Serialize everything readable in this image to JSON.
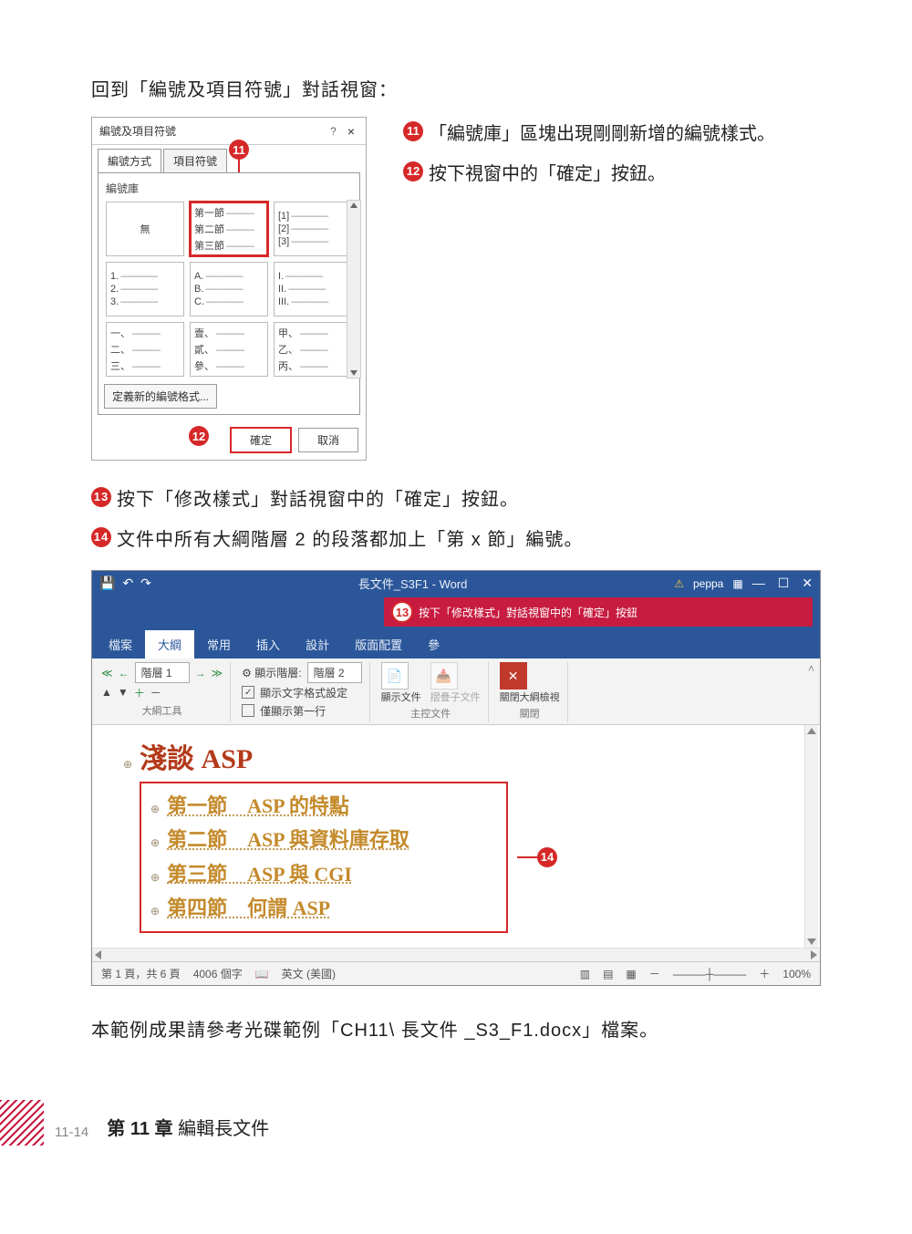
{
  "intro": "回到「編號及項目符號」對話視窗：",
  "dialog": {
    "title": "編號及項目符號",
    "help": "?",
    "close": "×",
    "tab_numbering": "編號方式",
    "tab_bullets": "項目符號",
    "library_label": "編號庫",
    "none": "無",
    "sec1": "第一節",
    "sec2": "第二節",
    "sec3": "第三節",
    "br1": "[1]",
    "br2": "[2]",
    "br3": "[3]",
    "n1": "1.",
    "n2": "2.",
    "n3": "3.",
    "a1": "A.",
    "a2": "B.",
    "a3": "C.",
    "r1": "I.",
    "r2": "II.",
    "r3": "III.",
    "cj1": "一、",
    "cj2": "二、",
    "cj3": "三、",
    "tw1": "壹、",
    "tw2": "貳、",
    "tw3": "參、",
    "jp1": "甲、",
    "jp2": "乙、",
    "jp3": "丙、",
    "define_new": "定義新的編號格式...",
    "ok": "確定",
    "cancel": "取消"
  },
  "callouts": {
    "c11": "11",
    "c12": "12",
    "c13": "13",
    "c14": "14"
  },
  "steps": {
    "s11": "「編號庫」區塊出現剛剛新增的編號樣式。",
    "s12": "按下視窗中的「確定」按鈕。",
    "s13": "按下「修改樣式」對話視窗中的「確定」按鈕。",
    "s14": "文件中所有大綱階層 2 的段落都加上「第 x 節」編號。"
  },
  "word": {
    "doc_title": "長文件_S3F1 - Word",
    "user": "peppa",
    "warn": "⚠",
    "banner": "按下「修改樣式」對話視窗中的「確定」按鈕",
    "tabs": {
      "file": "檔案",
      "outline": "大綱",
      "home": "常用",
      "insert": "插入",
      "design": "設計",
      "layout": "版面配置",
      "ref": "參"
    },
    "level_dd": "階層 1",
    "show_level_lbl": "顯示階層:",
    "show_level_val": "階層 2",
    "show_fmt": "顯示文字格式設定",
    "first_line": "僅顯示第一行",
    "group_outline": "大綱工具",
    "show_doc": "顯示文件",
    "collapse_sub": "摺疊子文件",
    "group_master": "主控文件",
    "close_view": "關閉大綱檢視",
    "group_close": "關閉",
    "h1": "淺談 ASP",
    "l2a": "第一節　ASP 的特點",
    "l2b": "第二節　ASP 與資料庫存取",
    "l2c": "第三節　ASP 與 CGI",
    "l2d": "第四節　何謂 ASP",
    "status_page": "第 1 頁，共 6 頁",
    "status_words": "4006 個字",
    "status_lang": "英文 (美國)",
    "zoom": "100%"
  },
  "footer_note": "本範例成果請參考光碟範例「CH11\\ 長文件 _S3_F1.docx」檔案。",
  "page_footer": {
    "num": "11-14",
    "chapter_bold": "第 11 章",
    "chapter_rest": "  編輯長文件"
  }
}
